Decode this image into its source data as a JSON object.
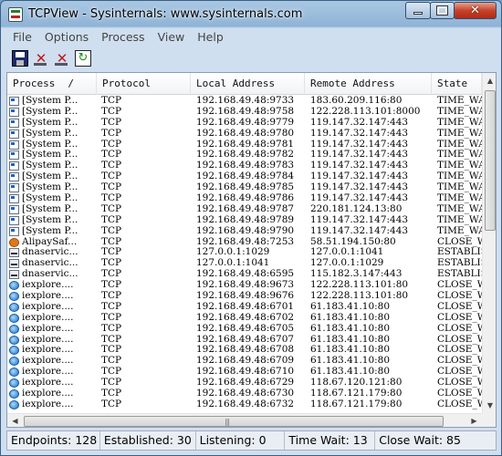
{
  "window": {
    "title": "TCPView - Sysinternals: www.sysinternals.com"
  },
  "menu": [
    "File",
    "Options",
    "Process",
    "View",
    "Help"
  ],
  "toolbar": [
    {
      "name": "save-icon"
    },
    {
      "name": "close-connection-icon"
    },
    {
      "name": "close-connection-alt-icon"
    },
    {
      "name": "refresh-icon"
    }
  ],
  "columns": [
    "Process",
    "Protocol",
    "Local Address",
    "Remote Address",
    "State"
  ],
  "sort_marker": "/",
  "rows": [
    {
      "icon": "sys",
      "process": "[System P...",
      "protocol": "TCP",
      "local": "192.168.49.48:9733",
      "remote": "183.60.209.116:80",
      "state": "TIME_WAIT"
    },
    {
      "icon": "sys",
      "process": "[System P...",
      "protocol": "TCP",
      "local": "192.168.49.48:9758",
      "remote": "122.228.113.101:8000",
      "state": "TIME_WAIT"
    },
    {
      "icon": "sys",
      "process": "[System P...",
      "protocol": "TCP",
      "local": "192.168.49.48:9779",
      "remote": "119.147.32.147:443",
      "state": "TIME_WAIT"
    },
    {
      "icon": "sys",
      "process": "[System P...",
      "protocol": "TCP",
      "local": "192.168.49.48:9780",
      "remote": "119.147.32.147:443",
      "state": "TIME_WAIT"
    },
    {
      "icon": "sys",
      "process": "[System P...",
      "protocol": "TCP",
      "local": "192.168.49.48:9781",
      "remote": "119.147.32.147:443",
      "state": "TIME_WAIT"
    },
    {
      "icon": "sys",
      "process": "[System P...",
      "protocol": "TCP",
      "local": "192.168.49.48:9782",
      "remote": "119.147.32.147:443",
      "state": "TIME_WAIT"
    },
    {
      "icon": "sys",
      "process": "[System P...",
      "protocol": "TCP",
      "local": "192.168.49.48:9783",
      "remote": "119.147.32.147:443",
      "state": "TIME_WAIT"
    },
    {
      "icon": "sys",
      "process": "[System P...",
      "protocol": "TCP",
      "local": "192.168.49.48:9784",
      "remote": "119.147.32.147:443",
      "state": "TIME_WAIT"
    },
    {
      "icon": "sys",
      "process": "[System P...",
      "protocol": "TCP",
      "local": "192.168.49.48:9785",
      "remote": "119.147.32.147:443",
      "state": "TIME_WAIT"
    },
    {
      "icon": "sys",
      "process": "[System P...",
      "protocol": "TCP",
      "local": "192.168.49.48:9786",
      "remote": "119.147.32.147:443",
      "state": "TIME_WAIT"
    },
    {
      "icon": "sys",
      "process": "[System P...",
      "protocol": "TCP",
      "local": "192.168.49.48:9787",
      "remote": "220.181.124.13:80",
      "state": "TIME_WAIT"
    },
    {
      "icon": "sys",
      "process": "[System P...",
      "protocol": "TCP",
      "local": "192.168.49.48:9789",
      "remote": "119.147.32.147:443",
      "state": "TIME_WAIT"
    },
    {
      "icon": "sys",
      "process": "[System P...",
      "protocol": "TCP",
      "local": "192.168.49.48:9790",
      "remote": "119.147.32.147:443",
      "state": "TIME_WAIT"
    },
    {
      "icon": "alipay",
      "process": "AlipaySaf...",
      "protocol": "TCP",
      "local": "192.168.49.48:7253",
      "remote": "58.51.194.150:80",
      "state": "CLOSE_WAIT"
    },
    {
      "icon": "dns",
      "process": "dnaservic...",
      "protocol": "TCP",
      "local": "127.0.0.1:1029",
      "remote": "127.0.0.1:1041",
      "state": "ESTABLISHED"
    },
    {
      "icon": "dns",
      "process": "dnaservic...",
      "protocol": "TCP",
      "local": "127.0.0.1:1041",
      "remote": "127.0.0.1:1029",
      "state": "ESTABLISHED"
    },
    {
      "icon": "dns",
      "process": "dnaservic...",
      "protocol": "TCP",
      "local": "192.168.49.48:6595",
      "remote": "115.182.3.147:443",
      "state": "ESTABLISHED"
    },
    {
      "icon": "ie",
      "process": "iexplore....",
      "protocol": "TCP",
      "local": "192.168.49.48:9673",
      "remote": "122.228.113.101:80",
      "state": "CLOSE_WAIT"
    },
    {
      "icon": "ie",
      "process": "iexplore....",
      "protocol": "TCP",
      "local": "192.168.49.48:9676",
      "remote": "122.228.113.101:80",
      "state": "CLOSE_WAIT"
    },
    {
      "icon": "ie",
      "process": "iexplore....",
      "protocol": "TCP",
      "local": "192.168.49.48:6701",
      "remote": "61.183.41.10:80",
      "state": "CLOSE_WAIT"
    },
    {
      "icon": "ie",
      "process": "iexplore....",
      "protocol": "TCP",
      "local": "192.168.49.48:6702",
      "remote": "61.183.41.10:80",
      "state": "CLOSE_WAIT"
    },
    {
      "icon": "ie",
      "process": "iexplore....",
      "protocol": "TCP",
      "local": "192.168.49.48:6705",
      "remote": "61.183.41.10:80",
      "state": "CLOSE_WAIT"
    },
    {
      "icon": "ie",
      "process": "iexplore....",
      "protocol": "TCP",
      "local": "192.168.49.48:6707",
      "remote": "61.183.41.10:80",
      "state": "CLOSE_WAIT"
    },
    {
      "icon": "ie",
      "process": "iexplore....",
      "protocol": "TCP",
      "local": "192.168.49.48:6708",
      "remote": "61.183.41.10:80",
      "state": "CLOSE_WAIT"
    },
    {
      "icon": "ie",
      "process": "iexplore....",
      "protocol": "TCP",
      "local": "192.168.49.48:6709",
      "remote": "61.183.41.10:80",
      "state": "CLOSE_WAIT"
    },
    {
      "icon": "ie",
      "process": "iexplore....",
      "protocol": "TCP",
      "local": "192.168.49.48:6710",
      "remote": "61.183.41.10:80",
      "state": "CLOSE_WAIT"
    },
    {
      "icon": "ie",
      "process": "iexplore....",
      "protocol": "TCP",
      "local": "192.168.49.48:6729",
      "remote": "118.67.120.121:80",
      "state": "CLOSE_WAIT"
    },
    {
      "icon": "ie",
      "process": "iexplore....",
      "protocol": "TCP",
      "local": "192.168.49.48:6730",
      "remote": "118.67.121.179:80",
      "state": "CLOSE_WAIT"
    },
    {
      "icon": "ie",
      "process": "iexplore....",
      "protocol": "TCP",
      "local": "192.168.49.48:6732",
      "remote": "118.67.121.179:80",
      "state": "CLOSE_WAIT"
    }
  ],
  "status": {
    "endpoints": "Endpoints: 128",
    "established": "Established: 30",
    "listening": "Listening: 0",
    "time_wait": "Time Wait: 13",
    "close_wait": "Close Wait: 85"
  }
}
